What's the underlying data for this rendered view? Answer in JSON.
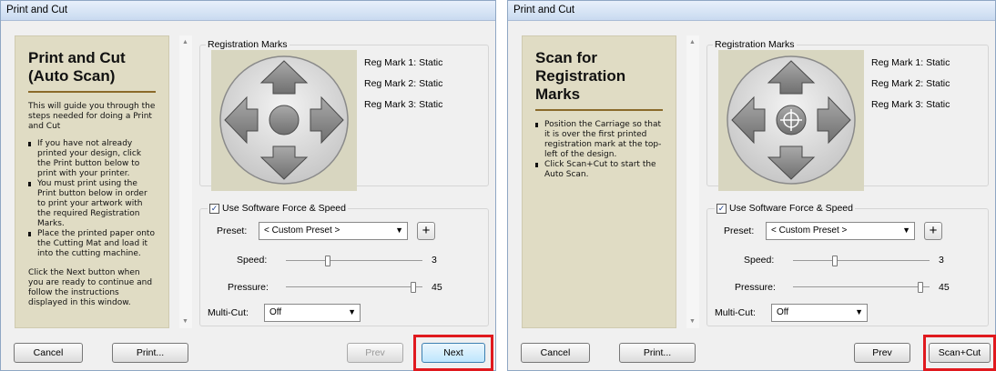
{
  "left_dialog": {
    "title": "Print and Cut",
    "side": {
      "heading": "Print and Cut (Auto Scan)",
      "intro": "This will guide you through the steps needed for doing a Print and Cut",
      "bullets": [
        "If you have not already printed your design, click the Print button below to print with your printer.",
        "You must print using the Print button below in order to print your artwork with the required Registration Marks.",
        "Place the printed paper onto the Cutting Mat and load it into the cutting machine."
      ],
      "outro": "Click the Next button when you are ready to continue and follow the instructions displayed in this window."
    },
    "registration": {
      "group_title": "Registration Marks",
      "marks": [
        "Reg Mark 1:  Static",
        "Reg Mark 2:  Static",
        "Reg Mark 3:  Static"
      ]
    },
    "force": {
      "use_label": "Use Software Force  & Speed",
      "checked_glyph": "✓",
      "preset_label": "Preset:",
      "preset_value": "< Custom Preset >",
      "plus": "+",
      "speed_label": "Speed:",
      "speed_value": "3",
      "speed_level": 0.3,
      "pressure_label": "Pressure:",
      "pressure_value": "45",
      "pressure_level": 0.95,
      "multicut_label": "Multi-Cut:",
      "multicut_value": "Off"
    },
    "buttons": {
      "cancel": "Cancel",
      "print": "Print...",
      "prev": "Prev",
      "next": "Next"
    }
  },
  "right_dialog": {
    "title": "Print and Cut",
    "side": {
      "heading": "Scan for Registration Marks",
      "bullets": [
        "Position the Carriage so that it is over the first printed registration mark at the top-left of the design.",
        "Click Scan+Cut to start the Auto Scan."
      ]
    },
    "registration": {
      "group_title": "Registration Marks",
      "marks": [
        "Reg Mark 1:  Static",
        "Reg Mark 2:  Static",
        "Reg Mark 3:  Static"
      ]
    },
    "force": {
      "use_label": "Use Software Force  & Speed",
      "checked_glyph": "✓",
      "preset_label": "Preset:",
      "preset_value": "< Custom Preset >",
      "plus": "+",
      "speed_label": "Speed:",
      "speed_value": "3",
      "speed_level": 0.3,
      "pressure_label": "Pressure:",
      "pressure_value": "45",
      "pressure_level": 0.95,
      "multicut_label": "Multi-Cut:",
      "multicut_value": "Off"
    },
    "buttons": {
      "cancel": "Cancel",
      "print": "Print...",
      "prev": "Prev",
      "scancut": "Scan+Cut"
    }
  },
  "colors": {
    "highlight": "#e0191e",
    "side_panel": "#e0dcc4",
    "heading_rule": "#8a6a2a"
  },
  "icons": [
    "arrow-up-icon",
    "arrow-down-icon",
    "arrow-left-icon",
    "arrow-right-icon",
    "center-button-icon",
    "crosshair-icon",
    "dropdown-arrow-icon"
  ]
}
